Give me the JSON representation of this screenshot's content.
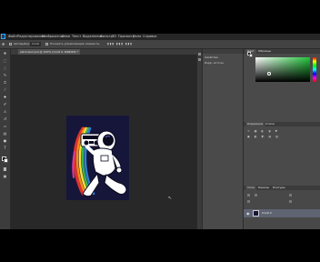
{
  "menubar": {
    "items": [
      "Файл",
      "Редактирование",
      "Изображение",
      "Слои",
      "Текст",
      "Выделение",
      "Фильтр",
      "3D",
      "Просмотр",
      "Окно",
      "Справка"
    ]
  },
  "options": {
    "tool_label": "Автовыбор:",
    "mode": "Слой",
    "transform_label": "Показать управляющие элементы"
  },
  "document": {
    "tab_title": "astronaut.psd @ 100% (Слой 0, RGB/8#) *"
  },
  "side_panel": {
    "lines": [
      "Свойства",
      "Корр. источн."
    ]
  },
  "color_panel": {
    "tabs": [
      "Цвет",
      "Образцы"
    ]
  },
  "adjust_panel": {
    "tabs": [
      "Коррекция",
      "Стили"
    ]
  },
  "layers_panel": {
    "tabs": [
      "Слои",
      "Каналы",
      "Контуры"
    ],
    "layer_name": "Слой 0"
  },
  "colors": {
    "app_bg": "#535353",
    "canvas_bg": "#282828",
    "artwork_bg": "#16163a",
    "selected_layer": "#5f6472"
  }
}
